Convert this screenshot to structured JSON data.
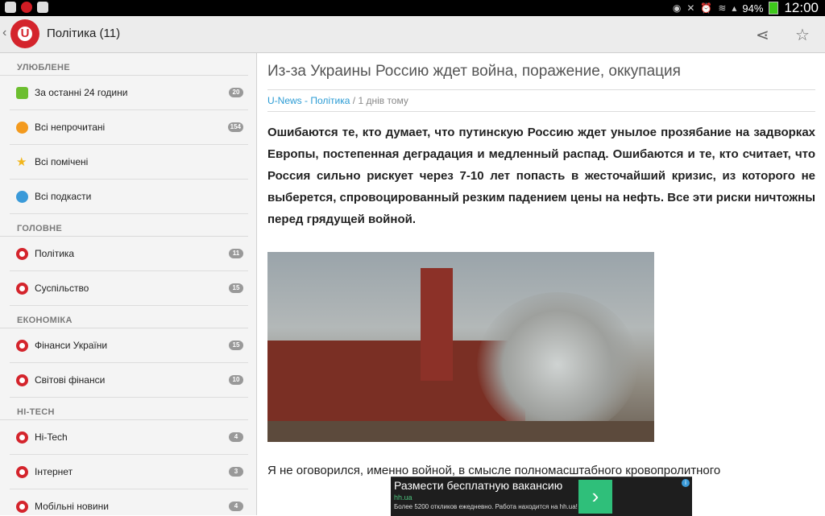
{
  "status_bar": {
    "battery": "94%",
    "time": "12:00"
  },
  "action_bar": {
    "title": "Політика (11)",
    "logo_letter": "U"
  },
  "sidebar": {
    "sections": [
      {
        "header": "УЛЮБЛЕНЕ",
        "items": [
          {
            "label": "За останні 24 години",
            "badge": "20",
            "icon": "rss-icon"
          },
          {
            "label": "Всі непрочитані",
            "badge": "154",
            "icon": "unread-icon"
          },
          {
            "label": "Всі помічені",
            "badge": "",
            "icon": "star-icon"
          },
          {
            "label": "Всі подкасти",
            "badge": "",
            "icon": "podcast-icon"
          }
        ]
      },
      {
        "header": "ГОЛОВНЕ",
        "items": [
          {
            "label": "Політика",
            "badge": "11",
            "icon": "unews-icon"
          },
          {
            "label": "Суспільство",
            "badge": "15",
            "icon": "unews-icon"
          }
        ]
      },
      {
        "header": "ЕКОНОМІКА",
        "items": [
          {
            "label": "Фінанси України",
            "badge": "15",
            "icon": "unews-icon"
          },
          {
            "label": "Світові фінанси",
            "badge": "10",
            "icon": "unews-icon"
          }
        ]
      },
      {
        "header": "HI-TECH",
        "items": [
          {
            "label": "Hi-Tech",
            "badge": "4",
            "icon": "unews-icon"
          },
          {
            "label": "Інтернет",
            "badge": "3",
            "icon": "unews-icon"
          },
          {
            "label": "Мобільні новини",
            "badge": "4",
            "icon": "unews-icon"
          }
        ]
      }
    ]
  },
  "article": {
    "title": "Из-за Украины Россию ждет война, поражение, оккупация",
    "source": "U-News - Політика",
    "separator": " / ",
    "age": "1 днів тому",
    "lead": "Ошибаются те, кто думает, что путинскую Россию ждет унылое прозябание на задворках Европы, постепенная деградация и медленный распад. Ошибаются и те, кто считает, что Россия сильно рискует через 7-10 лет попасть в жесточайший кризис, из которого не выберется, спровоцированный резким падением цены на нефть. Все эти риски ничтожны перед грядущей войной.",
    "continuation": "Я не оговорился, именно войной, в смысле полномасштабного кровопролитного"
  },
  "ad": {
    "title": "Размести бесплатную вакансию",
    "site": "hh.ua",
    "description": "Более 5200 откликов ежедневно. Работа находится на hh.ua!",
    "button_glyph": "›",
    "info_glyph": "i"
  },
  "colors": {
    "accent": "#d4242c",
    "link": "#2a9bd4",
    "ad_button": "#2fbf7a"
  }
}
